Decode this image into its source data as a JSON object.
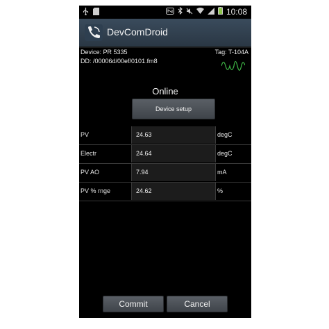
{
  "statusbar": {
    "time": "10:08",
    "battery_color": "#8bc34a"
  },
  "app": {
    "title": "DevComDroid",
    "header_color": "#34495e"
  },
  "device": {
    "name": "Device: PR 5335",
    "path": "DD: /00006d/00ef/0101.fm8",
    "tag": "Tag: T-104A",
    "wave_color": "#3cb043"
  },
  "status": "Online",
  "buttons": {
    "device_setup": "Device setup",
    "commit": "Commit",
    "cancel": "Cancel"
  },
  "rows": [
    {
      "label": "PV",
      "value": "24.63",
      "unit": "degC"
    },
    {
      "label": "Electr",
      "value": "24.64",
      "unit": "degC"
    },
    {
      "label": "PV AO",
      "value": "7.94",
      "unit": "mA"
    },
    {
      "label": "PV % rnge",
      "value": "24.62",
      "unit": "%"
    }
  ]
}
